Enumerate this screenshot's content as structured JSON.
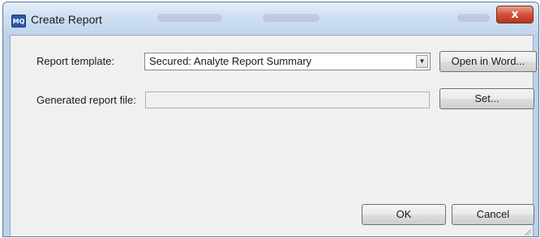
{
  "window": {
    "icon_text": "MQ",
    "title": "Create Report",
    "close_label": "x"
  },
  "form": {
    "template_label": "Report template:",
    "template_value": "Secured: Analyte Report Summary",
    "dropdown_arrow": "▼",
    "open_in_word_label": "Open in Word...",
    "generated_file_label": "Generated report file:",
    "generated_file_value": "",
    "set_label": "Set..."
  },
  "footer": {
    "ok_label": "OK",
    "cancel_label": "Cancel"
  },
  "colors": {
    "accent": "#2a57a8",
    "close_button": "#c8452f",
    "client_background": "#f0f0f0",
    "frame": "#bcd2ea"
  }
}
